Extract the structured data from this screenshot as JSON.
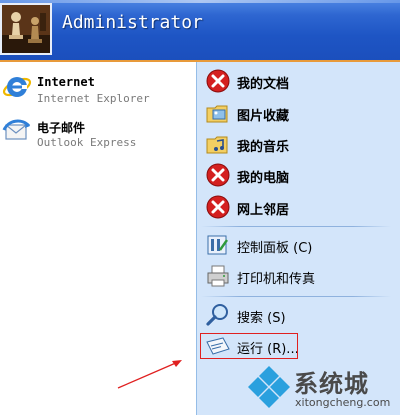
{
  "header": {
    "user_name": "Administrator"
  },
  "left_pane": {
    "pinned": [
      {
        "title": "Internet",
        "subtitle": "Internet Explorer",
        "icon": "internet-explorer-icon"
      },
      {
        "title": "电子邮件",
        "subtitle": "Outlook Express",
        "icon": "outlook-express-icon"
      }
    ]
  },
  "right_pane": {
    "items": [
      {
        "label": "我的文档",
        "icon": "error-x-icon"
      },
      {
        "label": "图片收藏",
        "icon": "pictures-folder-icon"
      },
      {
        "label": "我的音乐",
        "icon": "music-folder-icon"
      },
      {
        "label": "我的电脑",
        "icon": "error-x-icon"
      },
      {
        "label": "网上邻居",
        "icon": "error-x-icon"
      },
      {
        "label": "控制面板 (C)",
        "icon": "control-panel-icon"
      },
      {
        "label": "打印机和传真",
        "icon": "printer-icon"
      },
      {
        "label": "搜索 (S)",
        "icon": "search-icon"
      },
      {
        "label": "运行 (R)...",
        "icon": "run-icon"
      }
    ]
  },
  "watermark": {
    "brand": "系统城",
    "url": "xitongcheng.com"
  },
  "colors": {
    "header_blue": "#1e55c4",
    "right_pane_bg": "#d3e5fa",
    "highlight_red": "#e02020"
  }
}
